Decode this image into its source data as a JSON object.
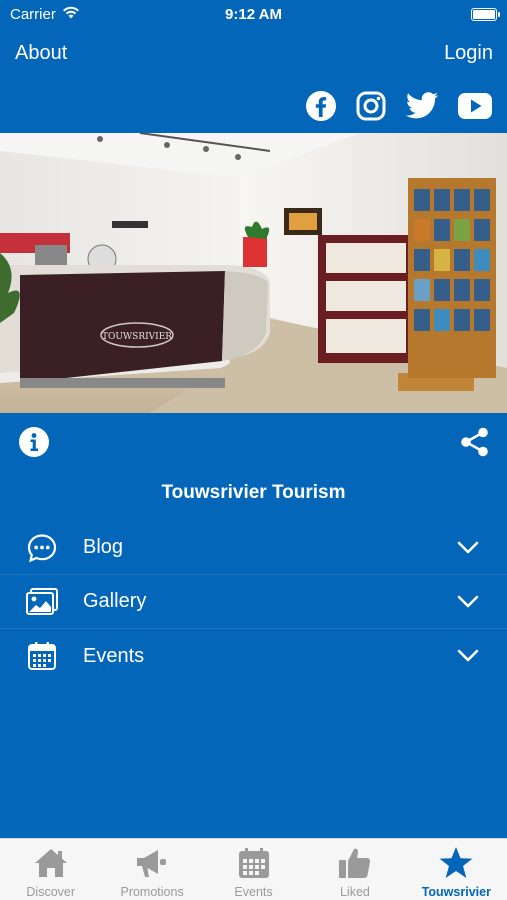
{
  "status_bar": {
    "carrier": "Carrier",
    "time": "9:12 AM"
  },
  "top_nav": {
    "left_label": "About",
    "right_label": "Login"
  },
  "social": [
    "facebook-icon",
    "instagram-icon",
    "twitter-icon",
    "youtube-icon"
  ],
  "hero": {
    "sign_text": "TOUWSRIVIER"
  },
  "section": {
    "title": "Touwsrivier Tourism"
  },
  "menu": [
    {
      "label": "Blog",
      "icon": "chat-bubble-icon"
    },
    {
      "label": "Gallery",
      "icon": "gallery-icon"
    },
    {
      "label": "Events",
      "icon": "calendar-icon"
    }
  ],
  "tabs": [
    {
      "label": "Discover",
      "icon": "home-icon",
      "active": false
    },
    {
      "label": "Promotions",
      "icon": "megaphone-icon",
      "active": false
    },
    {
      "label": "Events",
      "icon": "calendar-icon",
      "active": false
    },
    {
      "label": "Liked",
      "icon": "thumbs-up-icon",
      "active": false
    },
    {
      "label": "Touwsrivier",
      "icon": "star-icon",
      "active": true
    }
  ],
  "colors": {
    "primary": "#0366b8",
    "tab_inactive": "#9a9a9a",
    "tabbar_bg": "#f6f6f6"
  }
}
